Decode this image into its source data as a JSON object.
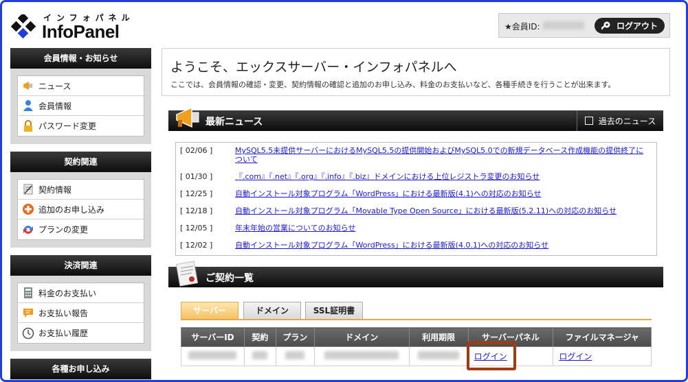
{
  "header": {
    "logo_kana": "インフォパネル",
    "logo_name": "InfoPanel",
    "member_label": "★会員ID:",
    "logout_label": "ログアウト"
  },
  "sidebar": [
    {
      "title": "会員情報・お知らせ",
      "items": [
        {
          "label": "ニュース",
          "icon": "megaphone-icon"
        },
        {
          "label": "会員情報",
          "icon": "person-icon"
        },
        {
          "label": "パスワード変更",
          "icon": "lock-icon"
        }
      ]
    },
    {
      "title": "契約関連",
      "items": [
        {
          "label": "契約情報",
          "icon": "contract-icon"
        },
        {
          "label": "追加のお申し込み",
          "icon": "plus-icon"
        },
        {
          "label": "プランの変更",
          "icon": "refresh-icon"
        }
      ]
    },
    {
      "title": "決済関連",
      "items": [
        {
          "label": "料金のお支払い",
          "icon": "calculator-icon"
        },
        {
          "label": "お支払い報告",
          "icon": "chat-icon"
        },
        {
          "label": "お支払い履歴",
          "icon": "clock-icon"
        }
      ]
    },
    {
      "title": "各種お申し込み",
      "items": []
    }
  ],
  "welcome": {
    "title": "ようこそ、エックスサーバー・インフォパネルへ",
    "description": "ここでは、会員情報の確認・変更、契約情報の確認と追加のお申し込み、料金のお支払いなど、各種手続きを行うことが出来ます。"
  },
  "news": {
    "title": "最新ニュース",
    "past_label": "過去のニュース",
    "items": [
      {
        "date": "[ 02/06 ]",
        "text": "MySQL5.5未提供サーバーにおけるMySQL5.5の提供開始およびMySQL5.0での新規データベース作成機能の提供終了について"
      },
      {
        "date": "[ 01/30 ]",
        "text": "『.com』『.net』『.org』『.info』『.biz』ドメインにおける上位レジストラ変更のお知らせ"
      },
      {
        "date": "[ 12/25 ]",
        "text": "自動インストール対象プログラム「WordPress」における最新版(4.1)への対応のお知らせ"
      },
      {
        "date": "[ 12/18 ]",
        "text": "自動インストール対象プログラム「Movable Type Open Source」における最新版(5.2.11)への対応のお知らせ"
      },
      {
        "date": "[ 12/05 ]",
        "text": "年末年始の営業についてのお知らせ"
      },
      {
        "date": "[ 12/02 ]",
        "text": "自動インストール対象プログラム「WordPress」における最新版(4.0.1)への対応のお知らせ"
      }
    ]
  },
  "contracts": {
    "title": "ご契約一覧",
    "tabs": [
      "サーバー",
      "ドメイン",
      "SSL証明書"
    ],
    "active_tab": 0,
    "columns": [
      "サーバーID",
      "契約",
      "プラン",
      "ドメイン",
      "利用期限",
      "サーバーパネル",
      "ファイルマネージャ"
    ],
    "rows": [
      {
        "server_panel": "ログイン",
        "file_manager": "ログイン"
      }
    ]
  },
  "colors": {
    "accent_tab": "#f5c265",
    "link": "#1a1ad4",
    "highlight_border": "#a23a12",
    "frame": "#1f3fd8"
  }
}
